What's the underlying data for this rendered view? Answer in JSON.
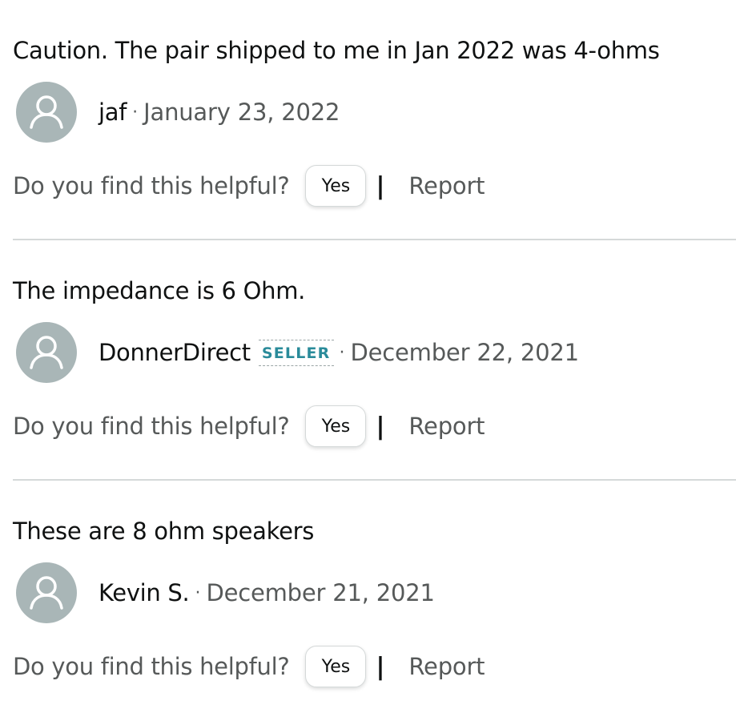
{
  "answers": [
    {
      "text": "Caution. The pair shipped to me in Jan 2022 was 4-ohms",
      "author": "jaf",
      "is_seller": false,
      "date": "January 23, 2022"
    },
    {
      "text": "The impedance is 6 Ohm.",
      "author": "DonnerDirect",
      "is_seller": true,
      "date": "December 22, 2021"
    },
    {
      "text": "These are 8 ohm speakers",
      "author": "Kevin S.",
      "is_seller": false,
      "date": "December 21, 2021"
    }
  ],
  "labels": {
    "separator": "·",
    "helpful_question": "Do you find this helpful?",
    "yes_button": "Yes",
    "pipe": "|",
    "report_link": "Report",
    "seller_badge": "SELLER"
  },
  "icons": {
    "avatar": "default-user-avatar-icon"
  },
  "colors": {
    "avatar_bg": "#a9b6b7",
    "seller_badge": "#2a8b9a",
    "secondary_text": "#565959",
    "divider": "#d5d9d9"
  }
}
